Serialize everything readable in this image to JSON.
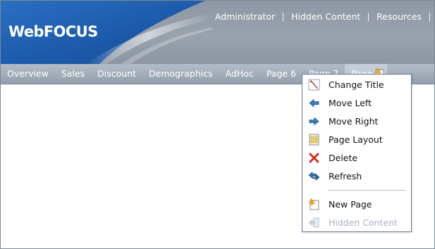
{
  "app": {
    "logo_text": "WebFOCUS"
  },
  "header": {
    "links": [
      {
        "label": "Administrator"
      },
      {
        "label": "Hidden Content"
      },
      {
        "label": "Resources"
      }
    ]
  },
  "tabs": [
    {
      "label": "Overview"
    },
    {
      "label": "Sales"
    },
    {
      "label": "Discount"
    },
    {
      "label": "Demographics"
    },
    {
      "label": "AdHoc"
    },
    {
      "label": "Page 6"
    },
    {
      "label": "Page 7"
    },
    {
      "label": "Page 8",
      "active": true
    }
  ],
  "new_tab_icon": "new-page-icon",
  "context_menu": {
    "items": [
      {
        "label": "Change Title",
        "icon": "pencil-icon",
        "enabled": true
      },
      {
        "label": "Move Left",
        "icon": "arrow-left-icon",
        "enabled": true
      },
      {
        "label": "Move Right",
        "icon": "arrow-right-icon",
        "enabled": true
      },
      {
        "label": "Page Layout",
        "icon": "page-layout-icon",
        "enabled": true
      },
      {
        "label": "Delete",
        "icon": "red-x-icon",
        "enabled": true
      },
      {
        "label": "Refresh",
        "icon": "refresh-icon",
        "enabled": true
      },
      {
        "label": "New Page",
        "icon": "new-page-icon",
        "enabled": true
      },
      {
        "label": "Hidden Content",
        "icon": "hidden-content-icon",
        "enabled": false
      }
    ]
  },
  "colors": {
    "banner_blue": "#1f5fb0",
    "tab_bar": "#a4aebb",
    "menu_border": "#6a7890",
    "disabled_text": "#a9b2bd"
  }
}
